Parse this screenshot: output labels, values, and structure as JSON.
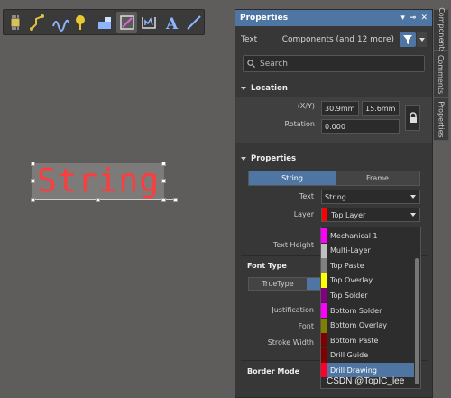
{
  "toolbar": {
    "tools": [
      {
        "icon": "component-icon"
      },
      {
        "icon": "route-icon"
      },
      {
        "icon": "interactive-route-icon"
      },
      {
        "icon": "place-pad-icon"
      },
      {
        "icon": "fill-icon"
      },
      {
        "icon": "region-icon"
      },
      {
        "icon": "dimension-icon"
      },
      {
        "icon": "text-icon"
      },
      {
        "icon": "line-icon"
      }
    ]
  },
  "canvas": {
    "string_text": "String"
  },
  "panel": {
    "title": "Properties",
    "filter_label": "Text",
    "filter_value": "Components (and 12 more)",
    "search_placeholder": "Search",
    "location": {
      "title": "Location",
      "xy_label": "(X/Y)",
      "x": "30.9mm",
      "y": "15.6mm",
      "rotation_label": "Rotation",
      "rotation": "0.000"
    },
    "properties": {
      "title": "Properties",
      "tab_string": "String",
      "tab_frame": "Frame",
      "text_label": "Text",
      "text_value": "String",
      "layer_label": "Layer",
      "layer_value": "Top Layer",
      "text_height_label": "Text Height",
      "font_type_title": "Font Type",
      "truetype_label": "TrueType",
      "justification_label": "Justification",
      "font_label": "Font",
      "stroke_width_label": "Stroke Width",
      "border_mode_title": "Border Mode"
    }
  },
  "side_tabs": [
    "Components",
    "Comments",
    "Properties"
  ],
  "layers": [
    {
      "name": "Mechanical 1",
      "color": "#ff00ff"
    },
    {
      "name": "Multi-Layer",
      "color": "#c0c0c0"
    },
    {
      "name": "Top Paste",
      "color": "#808080"
    },
    {
      "name": "Top Overlay",
      "color": "#ffff00"
    },
    {
      "name": "Top Solder",
      "color": "#800080"
    },
    {
      "name": "Bottom Solder",
      "color": "#ff00ff"
    },
    {
      "name": "Bottom Overlay",
      "color": "#808000"
    },
    {
      "name": "Bottom Paste",
      "color": "#800000"
    },
    {
      "name": "Drill Guide",
      "color": "#800000"
    },
    {
      "name": "Drill Drawing",
      "color": "#ff002a"
    }
  ],
  "selected_layer_color": "#ff0000",
  "watermark": "CSDN @TopIC_lee"
}
